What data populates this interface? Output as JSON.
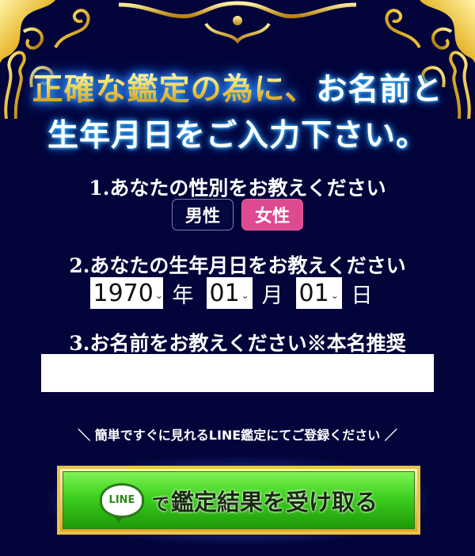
{
  "headline": {
    "line1_part1": "正確な鑑定の為に、",
    "line1_part2": "お名前と",
    "line2": "生年月日をご入力下さい。"
  },
  "questions": {
    "gender": "1.あなたの性別をお教えください",
    "birthdate": "2.あなたの生年月日をお教えください",
    "name": "3.お名前をお教えください※本名推奨"
  },
  "gender_options": {
    "male": "男性",
    "female": "女性",
    "selected": "female"
  },
  "birthdate": {
    "year_value": "1970",
    "year_unit": "年",
    "month_value": "01",
    "month_unit": "月",
    "day_value": "01",
    "day_unit": "日"
  },
  "name_input": {
    "value": "",
    "placeholder": ""
  },
  "notice": "＼ 簡単ですぐに見れるLINE鑑定にてご登録ください ／",
  "cta": {
    "badge": "LINE",
    "prefix": "で",
    "label": "鑑定結果を受け取る"
  },
  "colors": {
    "background": "#02043a",
    "female_selected": "#dd4a8f",
    "cta_green": "#3ccf1e",
    "gold": "#e9c44b"
  }
}
